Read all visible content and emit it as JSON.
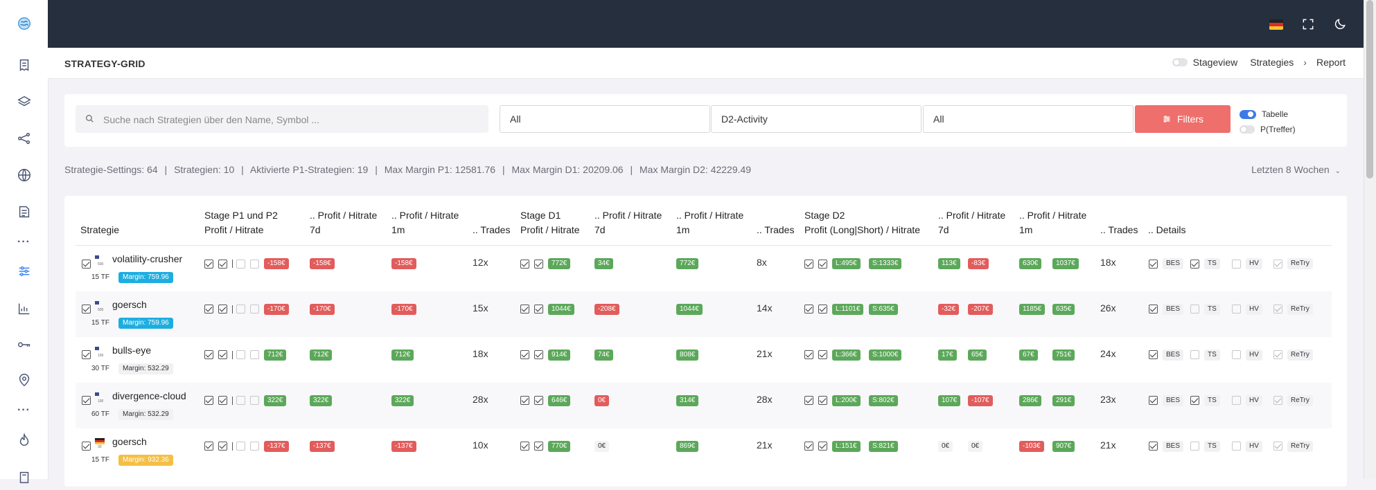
{
  "page_title": "STRATEGY-GRID",
  "header": {
    "stageview_label": "Stageview",
    "breadcrumb": [
      "Strategies",
      "Report"
    ]
  },
  "filters": {
    "search_placeholder": "Suche nach Strategien über den Name, Symbol ...",
    "select1": "All",
    "select2": "D2-Activity",
    "select3": "All",
    "filters_button": "Filters",
    "toggle_tabelle": "Tabelle",
    "toggle_ptreffer": "P(Treffer)"
  },
  "stats": {
    "settings": "Strategie-Settings: 64",
    "strategies": "Strategien: 10",
    "activated": "Aktivierte P1-Strategien: 19",
    "mm_p1": "Max Margin P1: 12581.76",
    "mm_d1": "Max Margin D1: 20209.06",
    "mm_d2": "Max Margin D2: 42229.49",
    "period": "Letzten 8 Wochen"
  },
  "columns": {
    "strategie": "Strategie",
    "p1p2_a": "Stage P1 und P2",
    "p1p2_b": "Profit / Hitrate",
    "ph_a": ".. Profit / Hitrate",
    "d7": "7d",
    "m1": "1m",
    "trades": ".. Trades",
    "d1_a": "Stage D1",
    "d1_b": "Profit / Hitrate",
    "d2_a": "Stage D2",
    "d2_b": "Profit (Long|Short) / Hitrate",
    "details": ".. Details"
  },
  "detail_tags": {
    "bes": "BES",
    "ts": "TS",
    "hv": "HV",
    "retry": "ReTry"
  },
  "rows": [
    {
      "name": "volatility-crusher",
      "tf": "15 TF",
      "margin": "Margin: 759.96",
      "margin_color": "blue",
      "flag": "us",
      "flag_tiny": "500",
      "p1": "-158€",
      "p1_c": "r",
      "p1_7d": "-158€",
      "p1_7d_c": "r",
      "p1_1m": "-158€",
      "p1_1m_c": "r",
      "p1_tr": "12x",
      "d1": "772€",
      "d1_c": "g",
      "d1_7d": "34€",
      "d1_7d_c": "g",
      "d1_1m": "772€",
      "d1_1m_c": "g",
      "d1_tr": "8x",
      "d2l": "L:495€",
      "d2s": "S:1333€",
      "d2_7a": "113€",
      "d2_7a_c": "g",
      "d2_7b": "-83€",
      "d2_7b_c": "r",
      "d2_1a": "630€",
      "d2_1a_c": "g",
      "d2_1b": "1037€",
      "d2_1b_c": "g",
      "d2_tr": "18x",
      "bes": true,
      "ts": true,
      "hv": false
    },
    {
      "name": "goersch",
      "tf": "15 TF",
      "margin": "Margin: 759.96",
      "margin_color": "blue",
      "flag": "us",
      "flag_tiny": "500",
      "p1": "-170€",
      "p1_c": "r",
      "p1_7d": "-170€",
      "p1_7d_c": "r",
      "p1_1m": "-170€",
      "p1_1m_c": "r",
      "p1_tr": "15x",
      "d1": "1044€",
      "d1_c": "g",
      "d1_7d": "-208€",
      "d1_7d_c": "r",
      "d1_1m": "1044€",
      "d1_1m_c": "g",
      "d1_tr": "14x",
      "d2l": "L:1101€",
      "d2s": "S:635€",
      "d2_7a": "-32€",
      "d2_7a_c": "r",
      "d2_7b": "-207€",
      "d2_7b_c": "r",
      "d2_1a": "1185€",
      "d2_1a_c": "g",
      "d2_1b": "635€",
      "d2_1b_c": "g",
      "d2_tr": "26x",
      "bes": true,
      "ts": false,
      "hv": false
    },
    {
      "name": "bulls-eye",
      "tf": "30 TF",
      "margin": "Margin: 532.29",
      "margin_color": "grey",
      "flag": "us",
      "flag_tiny": "100",
      "p1": "712€",
      "p1_c": "g",
      "p1_7d": "712€",
      "p1_7d_c": "g",
      "p1_1m": "712€",
      "p1_1m_c": "g",
      "p1_tr": "18x",
      "d1": "914€",
      "d1_c": "g",
      "d1_7d": "74€",
      "d1_7d_c": "g",
      "d1_1m": "808€",
      "d1_1m_c": "g",
      "d1_tr": "21x",
      "d2l": "L:366€",
      "d2s": "S:1000€",
      "d2_7a": "17€",
      "d2_7a_c": "g",
      "d2_7b": "65€",
      "d2_7b_c": "g",
      "d2_1a": "67€",
      "d2_1a_c": "g",
      "d2_1b": "751€",
      "d2_1b_c": "g",
      "d2_tr": "24x",
      "bes": true,
      "ts": false,
      "hv": false
    },
    {
      "name": "divergence-cloud",
      "tf": "60 TF",
      "margin": "Margin: 532.29",
      "margin_color": "grey",
      "flag": "us",
      "flag_tiny": "100",
      "p1": "322€",
      "p1_c": "g",
      "p1_7d": "322€",
      "p1_7d_c": "g",
      "p1_1m": "322€",
      "p1_1m_c": "g",
      "p1_tr": "28x",
      "d1": "646€",
      "d1_c": "g",
      "d1_7d": "0€",
      "d1_7d_c": "r",
      "d1_1m": "314€",
      "d1_1m_c": "g",
      "d1_tr": "28x",
      "d2l": "L:200€",
      "d2s": "S:802€",
      "d2_7a": "107€",
      "d2_7a_c": "g",
      "d2_7b": "-107€",
      "d2_7b_c": "r",
      "d2_1a": "286€",
      "d2_1a_c": "g",
      "d2_1b": "291€",
      "d2_1b_c": "g",
      "d2_tr": "23x",
      "bes": true,
      "ts": true,
      "hv": false
    },
    {
      "name": "goersch",
      "tf": "15 TF",
      "margin": "Margin: 932.36",
      "margin_color": "orange",
      "flag": "de",
      "flag_tiny": "30",
      "p1": "-137€",
      "p1_c": "r",
      "p1_7d": "-137€",
      "p1_7d_c": "r",
      "p1_1m": "-137€",
      "p1_1m_c": "r",
      "p1_tr": "10x",
      "d1": "770€",
      "d1_c": "g",
      "d1_7d": "0€",
      "d1_7d_c": "n",
      "d1_1m": "869€",
      "d1_1m_c": "g",
      "d1_tr": "21x",
      "d2l": "L:151€",
      "d2s": "S:821€",
      "d2_7a": "0€",
      "d2_7a_c": "n",
      "d2_7b": "0€",
      "d2_7b_c": "n",
      "d2_1a": "-103€",
      "d2_1a_c": "r",
      "d2_1b": "907€",
      "d2_1b_c": "g",
      "d2_tr": "21x",
      "bes": true,
      "ts": false,
      "hv": false
    }
  ],
  "colors": {
    "topbar": "#252f3e",
    "accent": "#3b82f6",
    "filters_btn": "#ef6f6c",
    "green": "#5ca85a",
    "red": "#e25c5c",
    "blue_margin": "#1daee1",
    "orange_margin": "#f5bf45"
  },
  "sidebar_icons": [
    "logo-icon",
    "document-icon",
    "layers-icon",
    "share-icon",
    "globe-icon",
    "report-icon",
    "more-icon",
    "sliders-icon",
    "chart-icon",
    "key-icon",
    "pin-icon",
    "more-icon",
    "flame-icon",
    "doc-icon"
  ],
  "topbar_icons": [
    "flag-de-icon",
    "fullscreen-icon",
    "moon-icon"
  ]
}
